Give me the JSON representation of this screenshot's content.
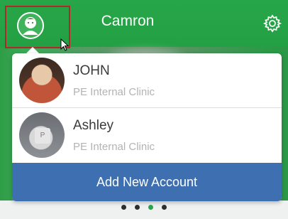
{
  "header": {
    "title": "Camron",
    "avatar_icon": "user-avatar-icon",
    "settings_icon": "gear-icon"
  },
  "accounts": [
    {
      "name": "JOHN",
      "clinic": "PE Internal Clinic",
      "photo_icon": "profile-photo"
    },
    {
      "name": "Ashley",
      "clinic": "PE Internal Clinic",
      "photo_icon": "profile-photo",
      "photo_key_letter": "P"
    }
  ],
  "add_account_label": "Add New Account",
  "pager": {
    "count": 4,
    "active_index": 2
  },
  "colors": {
    "header_green": "#27a648",
    "highlight_red": "#b3262a",
    "button_blue": "#3e6fb0",
    "name_text": "#3a3a3a",
    "clinic_text": "#b3b3b3"
  }
}
